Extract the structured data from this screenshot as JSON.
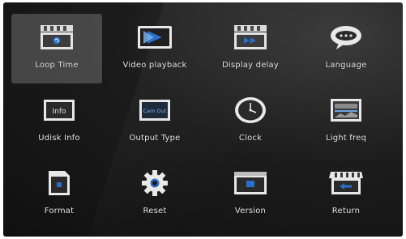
{
  "menu": {
    "selected_index": 0,
    "items": [
      {
        "label": "Loop Time",
        "icon": "clapperboard-icon"
      },
      {
        "label": "Video playback",
        "icon": "video-play-icon"
      },
      {
        "label": "Display delay",
        "icon": "delay-clapperboard-icon"
      },
      {
        "label": "Language",
        "icon": "language-bubble-icon"
      },
      {
        "label": "Udisk Info",
        "icon": "info-icon",
        "icon_text": "Info"
      },
      {
        "label": "Output Type",
        "icon": "output-type-icon",
        "icon_text": "Cam Out"
      },
      {
        "label": "Clock",
        "icon": "clock-icon"
      },
      {
        "label": "Light freq",
        "icon": "light-freq-icon"
      },
      {
        "label": "Format",
        "icon": "sd-card-icon"
      },
      {
        "label": "Reset",
        "icon": "gear-icon"
      },
      {
        "label": "Version",
        "icon": "version-icon"
      },
      {
        "label": "Return",
        "icon": "return-store-icon"
      }
    ]
  },
  "colors": {
    "accent": "#2a6fc9",
    "icon_light": "#e8e8e8",
    "label": "#e6e6e6",
    "selected_bg": "#6e6e6e"
  }
}
